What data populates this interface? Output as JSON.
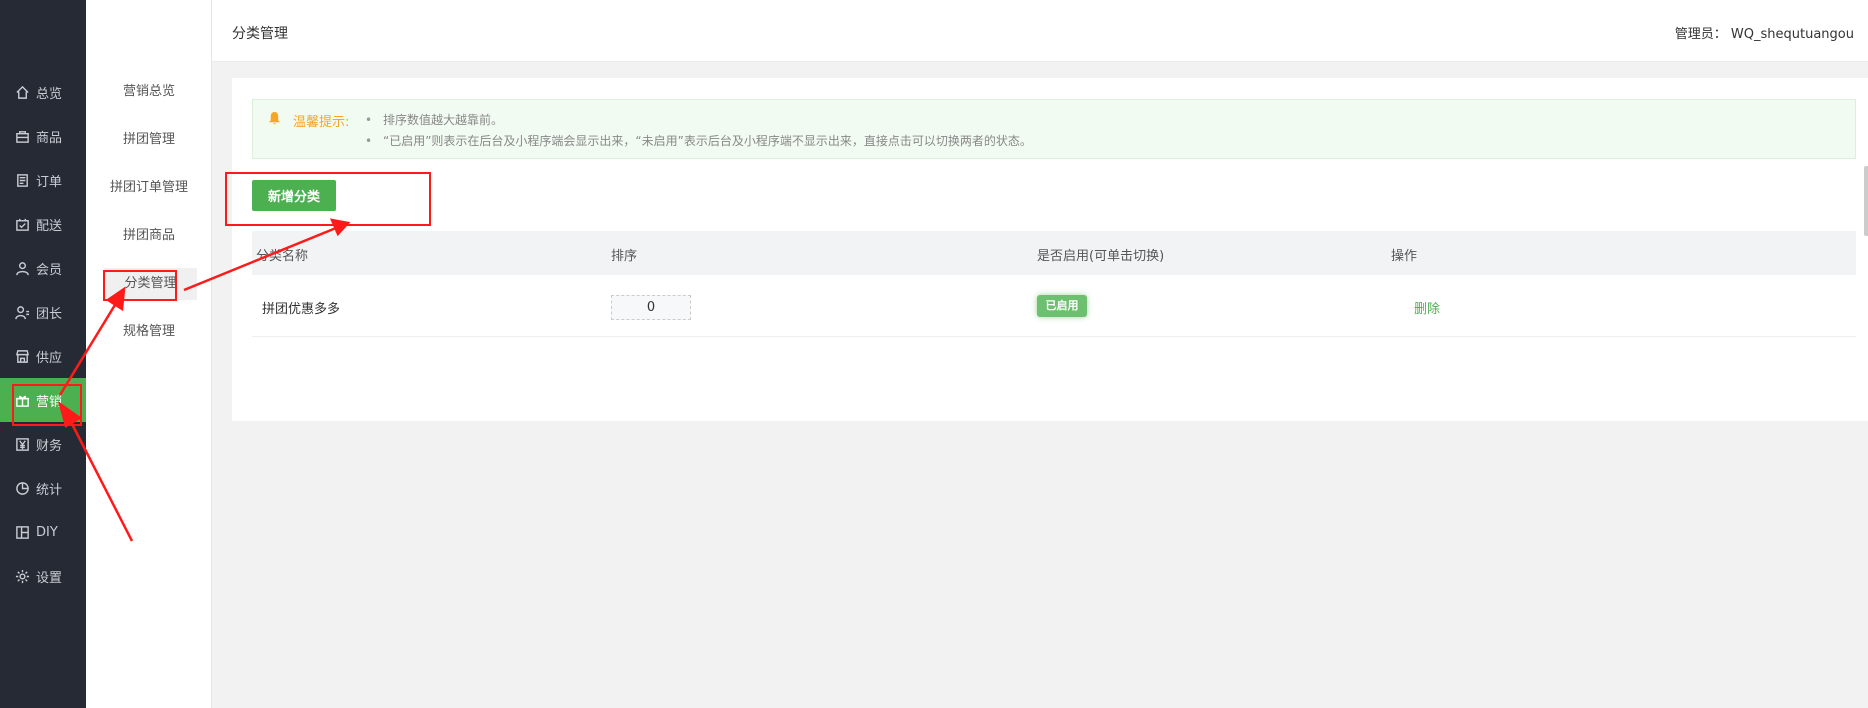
{
  "sidebar": {
    "items": [
      {
        "label": "总览",
        "icon": "home-icon"
      },
      {
        "label": "商品",
        "icon": "box-icon"
      },
      {
        "label": "订单",
        "icon": "order-icon"
      },
      {
        "label": "配送",
        "icon": "delivery-icon"
      },
      {
        "label": "会员",
        "icon": "user-icon"
      },
      {
        "label": "团长",
        "icon": "leader-icon"
      },
      {
        "label": "供应",
        "icon": "store-icon"
      },
      {
        "label": "营销",
        "icon": "gift-icon",
        "active": true
      },
      {
        "label": "财务",
        "icon": "yen-icon"
      },
      {
        "label": "统计",
        "icon": "pie-chart-icon"
      },
      {
        "label": "DIY",
        "icon": "layout-icon"
      },
      {
        "label": "设置",
        "icon": "gear-icon"
      }
    ]
  },
  "subnav": {
    "items": [
      {
        "label": "营销总览"
      },
      {
        "label": "拼团管理"
      },
      {
        "label": "拼团订单管理"
      },
      {
        "label": "拼团商品"
      },
      {
        "label": "分类管理",
        "active": true
      },
      {
        "label": "规格管理"
      }
    ]
  },
  "header": {
    "title": "分类管理",
    "admin": "管理员： WQ_shequtuangou"
  },
  "notice": {
    "label": "温馨提示:",
    "tips": [
      "排序数值越大越靠前。",
      "“已启用”则表示在后台及小程序端会显示出来，“未启用”表示后台及小程序端不显示出来，直接点击可以切换两者的状态。"
    ]
  },
  "toolbar": {
    "add_label": "新增分类"
  },
  "table": {
    "headers": [
      "分类名称",
      "排序",
      "是否启用(可单击切换)",
      "操作"
    ],
    "rows": [
      {
        "name": "拼团优惠多多",
        "sort": "0",
        "status": "已启用",
        "action": "删除"
      }
    ]
  },
  "colors": {
    "accent": "#4cb050",
    "sidebar_bg": "#262a35",
    "annotation": "#ff1a1a",
    "notice_label": "#f5a623"
  }
}
